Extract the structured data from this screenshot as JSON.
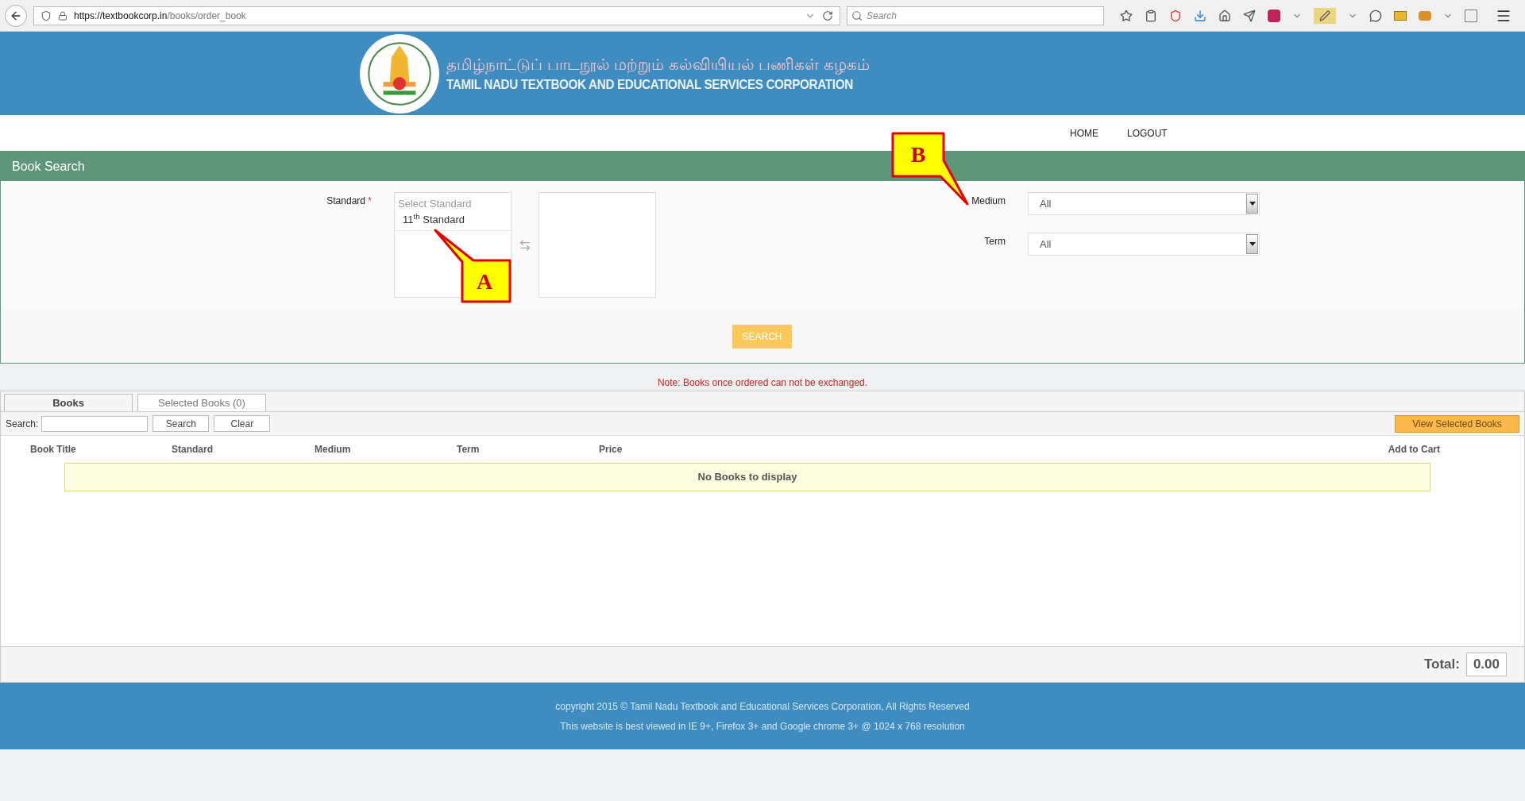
{
  "browser": {
    "url_host": "https://textbookcorp.in",
    "url_path": "/books/order_book",
    "search_placeholder": "Search"
  },
  "header": {
    "title_tamil": "தமிழ்நாட்டுப் பாடநூல் மற்றும் கல்வியியல் பணிகள் கழகம்",
    "title_english": "TAMIL NADU TEXTBOOK AND EDUCATIONAL SERVICES CORPORATION"
  },
  "nav": [
    {
      "label": "HOME"
    },
    {
      "label": "LOGOUT"
    }
  ],
  "panel_title": "Book Search",
  "form": {
    "standard_label": "Standard",
    "required_mark": "*",
    "standard_options": [
      {
        "label": "Select Standard",
        "kind": "placeholder"
      },
      {
        "label": "11$^{th}$ Standard",
        "kind": "option"
      }
    ],
    "medium": {
      "label": "Medium",
      "value": "All"
    },
    "term": {
      "label": "Term",
      "value": "All"
    },
    "search_button": "SEARCH"
  },
  "note": "Note: Books once ordered can not be exchanged.",
  "tabs": [
    {
      "label": "Books",
      "selected": true
    },
    {
      "label": "Selected Books (0)",
      "selected": false
    }
  ],
  "search": {
    "label": "Search:",
    "buttons": [
      "Search",
      "Clear"
    ],
    "view_button": "View Selected Books"
  },
  "table": {
    "columns": [
      "Book Title",
      "Standard",
      "Medium",
      "Term",
      "Price",
      "Add to Cart"
    ],
    "empty_message": "No Books to display"
  },
  "total": {
    "label": "Total:",
    "value": "0.00"
  },
  "footer": [
    "copyright 2015 © Tamil Nadu Textbook and Educational Services Corporation, All Rights Reserved",
    "This website is best viewed in IE 9+, Firefox 3+ and Google chrome 3+ @ 1024 x 768 resolution"
  ],
  "callouts": [
    {
      "label": "A"
    },
    {
      "label": "B"
    }
  ]
}
